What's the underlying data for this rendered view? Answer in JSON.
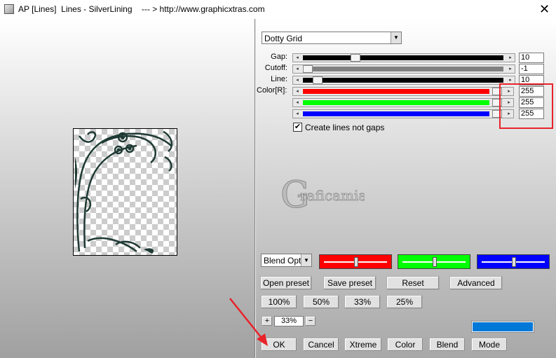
{
  "window": {
    "title": "AP [Lines]  Lines - SilverLining    --- > http://www.graphicxtras.com",
    "close_glyph": "✕"
  },
  "effect_select": {
    "value": "Dotty Grid"
  },
  "sliders": [
    {
      "id": "gap",
      "label": "Gap:",
      "value": "10",
      "fraction": 0.25,
      "fill_color": "#000000"
    },
    {
      "id": "cutoff",
      "label": "Cutoff:",
      "value": "-1",
      "fraction": 0.0,
      "fill_color": "#808080"
    },
    {
      "id": "line",
      "label": "Line:",
      "value": "10",
      "fraction": 0.05,
      "fill_color": "#000000"
    },
    {
      "id": "color-r",
      "label": "Color[R]:",
      "value": "255",
      "fraction": 1.0,
      "fill_color": "#ff0000"
    },
    {
      "id": "color-g",
      "label": "",
      "value": "255",
      "fraction": 1.0,
      "fill_color": "#00ff00"
    },
    {
      "id": "color-b",
      "label": "",
      "value": "255",
      "fraction": 1.0,
      "fill_color": "#0000ff"
    }
  ],
  "checkbox": {
    "label": "Create lines not gaps",
    "checked": true,
    "mark": "✔"
  },
  "watermark": {
    "text": "raficamia",
    "initial": "G"
  },
  "blend_select": {
    "value": "Blend Opti"
  },
  "swatches": [
    {
      "color": "#ff0000",
      "fraction": 0.5
    },
    {
      "color": "#00ff00",
      "fraction": 0.5
    },
    {
      "color": "#0000ff",
      "fraction": 0.5
    }
  ],
  "buttons": {
    "open_preset": "Open preset",
    "save_preset": "Save preset",
    "reset": "Reset",
    "advanced": "Advanced",
    "zoom_100": "100%",
    "zoom_50": "50%",
    "zoom_33": "33%",
    "zoom_25": "25%",
    "plus": "+",
    "minus": "−",
    "zoom_value": "33%",
    "ok": "OK",
    "cancel": "Cancel",
    "xtreme": "Xtreme",
    "color": "Color",
    "blend": "Blend",
    "mode": "Mode"
  },
  "colors": {
    "accent_bar": "#0078d7",
    "highlight": "#e8232a"
  }
}
